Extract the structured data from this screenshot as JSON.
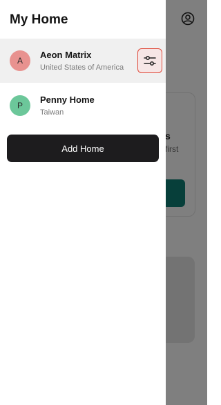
{
  "drawer": {
    "title": "My Home",
    "homes": [
      {
        "initial": "A",
        "name": "Aeon Matrix",
        "location": "United States of America",
        "avatar_color": "#e8928f",
        "selected": true
      },
      {
        "initial": "P",
        "name": "Penny Home",
        "location": "Taiwan",
        "avatar_color": "#6cc79a",
        "selected": false
      }
    ],
    "add_home_label": "Add Home",
    "settings_icon": "sliders-icon"
  },
  "background": {
    "card_title": "s",
    "card_subtitle": "first",
    "profile_icon": "user-circle-icon",
    "accent_color": "#0f7f74"
  }
}
